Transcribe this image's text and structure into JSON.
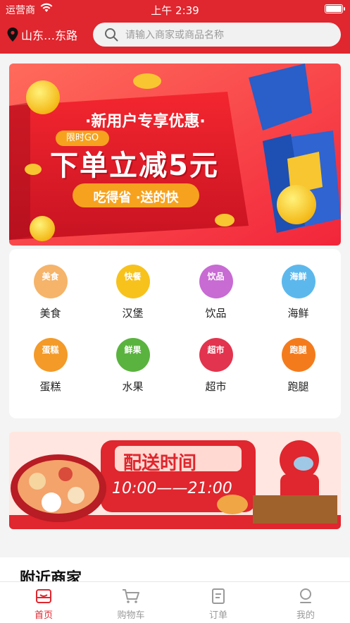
{
  "status_bar": {
    "carrier": "运营商",
    "time": "上午 2:39"
  },
  "header": {
    "location": "山东…东路",
    "search_placeholder": "请输入商家或商品名称"
  },
  "banner": {
    "badge": "限时GO",
    "headline_small": "·新用户专享优惠·",
    "headline_big": "下单立减5元",
    "tagline": "吃得省 ·送的快"
  },
  "categories": [
    {
      "label": "美食",
      "tag": "美食",
      "color": "#f5b46a"
    },
    {
      "label": "汉堡",
      "tag": "快餐",
      "color": "#f7c21c"
    },
    {
      "label": "饮品",
      "tag": "饮品",
      "color": "#c86bd3"
    },
    {
      "label": "海鲜",
      "tag": "海鲜",
      "color": "#5cb8ec"
    },
    {
      "label": "蛋糕",
      "tag": "蛋糕",
      "color": "#f39a28"
    },
    {
      "label": "水果",
      "tag": "鲜果",
      "color": "#5ab33e"
    },
    {
      "label": "超市",
      "tag": "超市",
      "color": "#e2344e"
    },
    {
      "label": "跑腿",
      "tag": "跑腿",
      "color": "#f47b1c"
    }
  ],
  "delivery_banner": {
    "title": "配送时间",
    "hours": "10:00——21:00"
  },
  "nearby": {
    "title": "附近商家"
  },
  "tabbar": {
    "items": [
      {
        "label": "首页",
        "icon": "home-icon",
        "active": true
      },
      {
        "label": "购物车",
        "icon": "cart-icon",
        "active": false
      },
      {
        "label": "订单",
        "icon": "order-icon",
        "active": false
      },
      {
        "label": "我的",
        "icon": "profile-icon",
        "active": false
      }
    ]
  },
  "colors": {
    "primary": "#e0262e"
  }
}
